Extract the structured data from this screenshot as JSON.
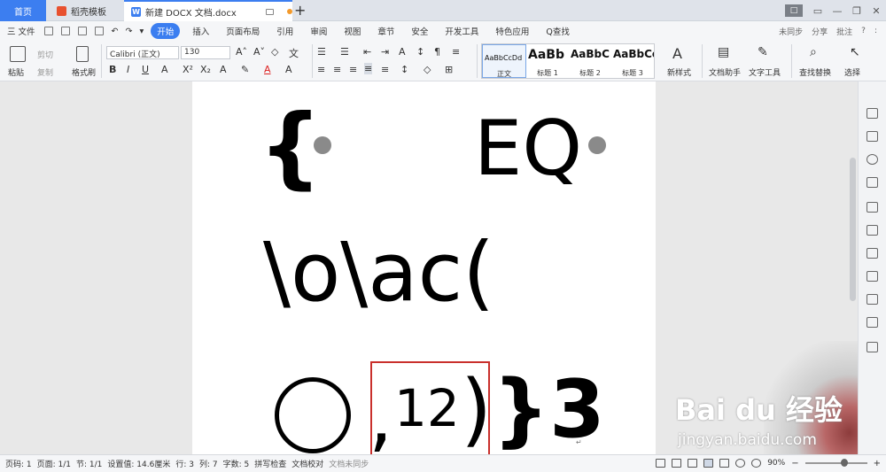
{
  "tabs": {
    "home": "首页",
    "template": "稻壳模板",
    "document": "新建 DOCX 文档.docx",
    "new_tab": "+"
  },
  "menu": {
    "file": "三 文件",
    "start": "开始",
    "items": [
      "插入",
      "页面布局",
      "引用",
      "审阅",
      "视图",
      "章节",
      "安全",
      "开发工具",
      "特色应用"
    ],
    "search": "Q查找",
    "right": [
      "未同步",
      "分享",
      "批注",
      "?",
      ":"
    ]
  },
  "ribbon": {
    "paste": "粘贴",
    "cut": "剪切",
    "copy": "复制",
    "format_painter": "格式刷",
    "font_name": "Calibri (正文)",
    "font_size": "130",
    "styles": [
      {
        "preview": "AaBbCcDd",
        "label": "正文"
      },
      {
        "preview": "AaBb",
        "label": "标题 1"
      },
      {
        "preview": "AaBbC",
        "label": "标题 2"
      },
      {
        "preview": "AaBbCc",
        "label": "标题 3"
      }
    ],
    "new_style": "新样式",
    "doc_helper": "文档助手",
    "text_tools": "文字工具",
    "find_replace": "查找替换",
    "select": "选择"
  },
  "document": {
    "line1_brace": "{",
    "line1_eq": "EQ",
    "line2": "\\o\\ac(",
    "line3_comma": ",",
    "line3_num": "12",
    "line3_paren": ")",
    "line3_close": "}3",
    "para_mark": "↵"
  },
  "status": {
    "page": "页码: 1",
    "pages": "页面: 1/1",
    "section": "节: 1/1",
    "setting": "设置值: 14.6厘米",
    "row": "行: 3",
    "col": "列: 7",
    "words": "字数: 5",
    "spell": "拼写检查",
    "proof": "文档校对",
    "sync": "文档未同步",
    "zoom": "90%"
  },
  "watermark": {
    "brand": "Bai du 经验",
    "url": "jingyan.baidu.com"
  },
  "colors": {
    "accent": "#3b7ef0",
    "highlight_box": "#c9302c"
  }
}
